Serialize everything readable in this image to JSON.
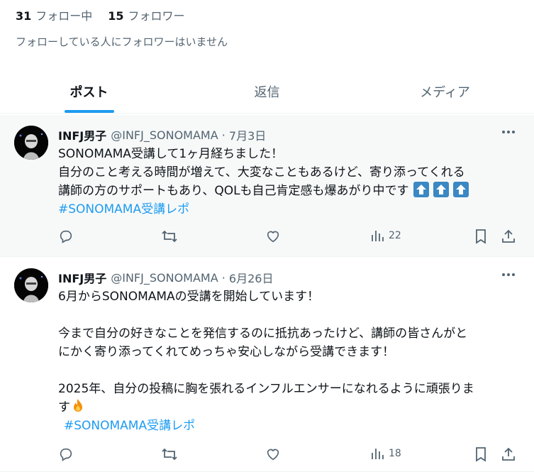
{
  "profile": {
    "following_count": "31",
    "following_label": "フォロー中",
    "followers_count": "15",
    "followers_label": "フォロワー",
    "follow_note": "フォローしている人にフォロワーはいません"
  },
  "tabs": [
    {
      "label": "ポスト",
      "active": true
    },
    {
      "label": "返信",
      "active": false
    },
    {
      "label": "メディア",
      "active": false
    }
  ],
  "posts": [
    {
      "author": "INFJ男子",
      "handle": "@INFJ_SONOMAMA",
      "date": "7月3日",
      "text": "SONOMAMA受講して1ヶ月経ちました！\n自分のこと考える時間が増えて、大変なこともあるけど、寄り添ってくれる\n講師の方のサポートもあり、QOLも自己肯定感も爆あがり中です",
      "emojis": [
        "up-arrow-icon",
        "up-arrow-icon",
        "up-arrow-icon"
      ],
      "hashtag": "#SONOMAMA受講レポ",
      "views": "22"
    },
    {
      "author": "INFJ男子",
      "handle": "@INFJ_SONOMAMA",
      "date": "6月26日",
      "text": "6月からSONOMAMAの受講を開始しています！\n\n今まで自分の好きなことを発信するのに抵抗あったけど、講師の皆さんがと\nにかく寄り添ってくれてめっちゃ安心しながら受講できます！\n\n2025年、自分の投稿に胸を張れるインフルエンサーになれるように頑張りま\nす",
      "emojis": [
        "fire-icon"
      ],
      "hashtag": "#SONOMAMA受講レポ",
      "views": "18"
    }
  ],
  "colors": {
    "accent": "#1d9bf0",
    "secondary_text": "#536471",
    "highlight_bg": "#f7f9f9"
  }
}
